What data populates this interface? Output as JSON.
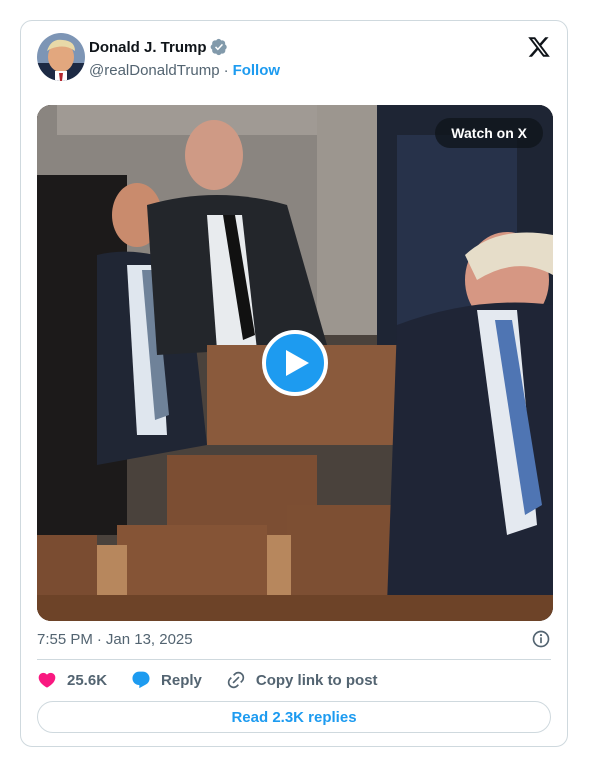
{
  "author": {
    "name": "Donald J. Trump",
    "handle": "@realDonaldTrump",
    "separator": "·",
    "follow_label": "Follow"
  },
  "media": {
    "watch_label": "Watch on X"
  },
  "post": {
    "time": "7:55 PM",
    "separator": "·",
    "date": "Jan 13, 2025"
  },
  "actions": {
    "likes": "25.6K",
    "reply_label": "Reply",
    "copy_link_label": "Copy link to post"
  },
  "replies": {
    "read_label": "Read 2.3K replies"
  },
  "colors": {
    "accent": "#1d9bf0",
    "like": "#f91880",
    "text_secondary": "#536471",
    "border": "#cfd9de"
  }
}
